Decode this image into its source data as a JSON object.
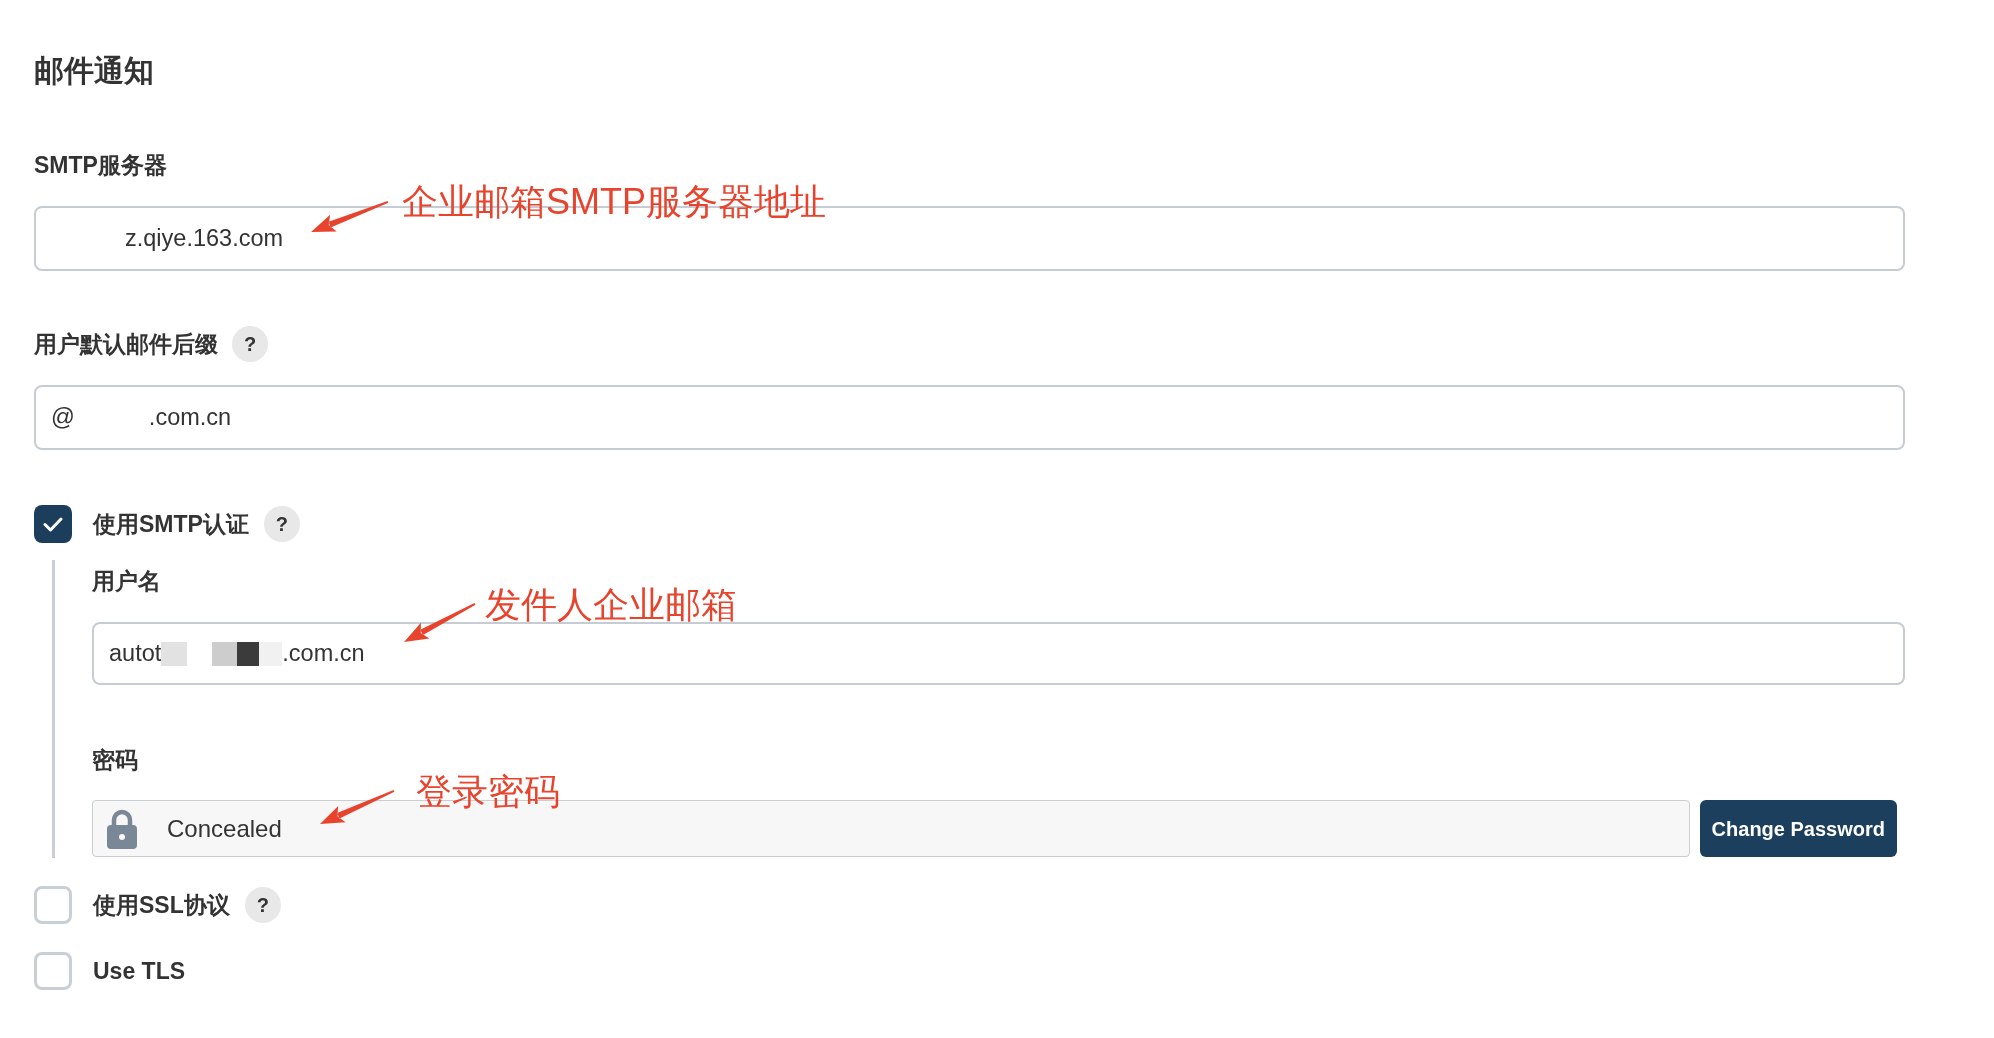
{
  "section": {
    "title": "邮件通知"
  },
  "fields": [
    {
      "label": "SMTP服务器",
      "segments": [
        {
          "kind": "blank"
        },
        {
          "kind": "text",
          "text": "z.qiye.163.com"
        }
      ],
      "annotation": "企业邮箱SMTP服务器地址"
    },
    {
      "label": "用户默认邮件后缀",
      "help": "?",
      "segments": [
        {
          "kind": "text",
          "text": "@"
        },
        {
          "kind": "blank"
        },
        {
          "kind": "text",
          "text": ".com.cn"
        }
      ]
    }
  ],
  "smtp_auth": {
    "label": "使用SMTP认证",
    "help": "?",
    "checked": true,
    "username": {
      "label": "用户名",
      "segments": [
        {
          "kind": "text",
          "text": "autot"
        },
        {
          "kind": "mosaic"
        },
        {
          "kind": "text",
          "text": ".com.cn"
        }
      ],
      "annotation": "发件人企业邮箱"
    },
    "password": {
      "label": "密码",
      "value": "Concealed",
      "button": "Change Password",
      "annotation": "登录密码"
    }
  },
  "options": [
    {
      "label": "使用SSL协议",
      "help": "?",
      "checked": false
    },
    {
      "label": "Use TLS",
      "checked": false
    }
  ]
}
